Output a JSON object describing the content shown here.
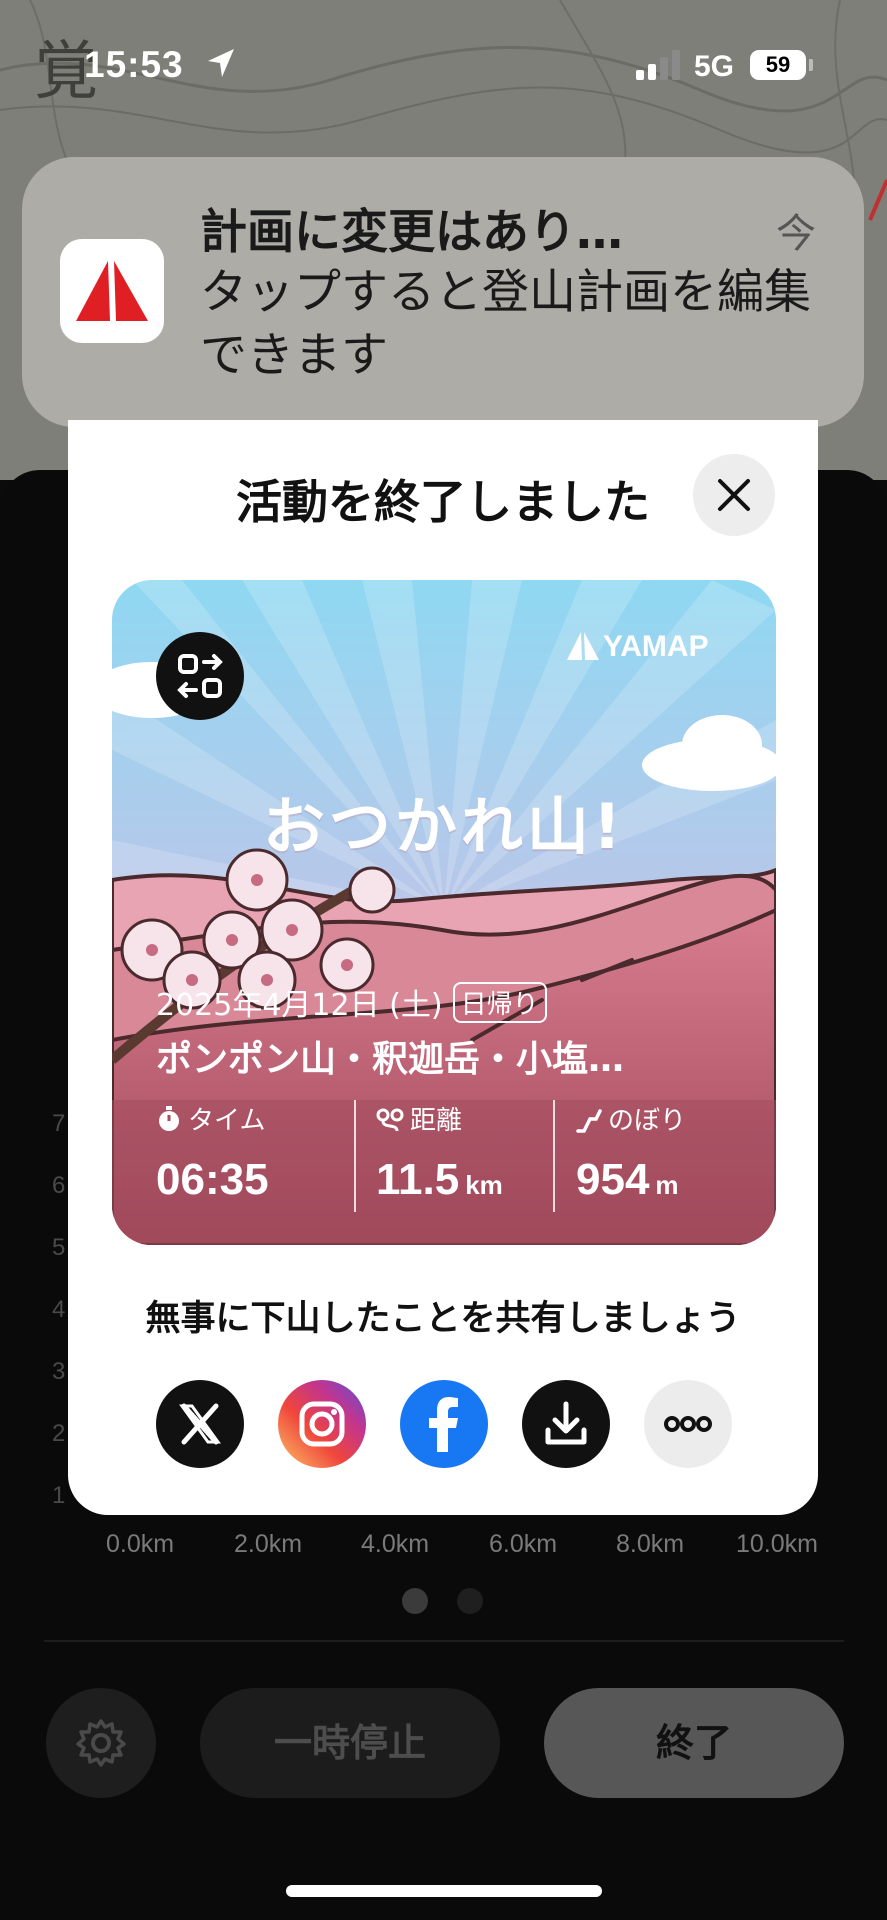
{
  "status_bar": {
    "time": "15:53",
    "network": "5G",
    "battery": "59"
  },
  "map": {
    "label": "覚"
  },
  "notification": {
    "title": "計画に変更はあり…",
    "time": "今",
    "body": "タップすると登山計画を編集できます"
  },
  "modal": {
    "title": "活動を終了しました",
    "card": {
      "brand": "YAMAP",
      "headline": "おつかれ山!",
      "date": "2025年4月12日 (土)",
      "trip_type": "日帰り",
      "mountains": "ポンポン山・釈迦岳・小塩…",
      "stats": [
        {
          "label": "タイム",
          "value": "06:35",
          "unit": ""
        },
        {
          "label": "距離",
          "value": "11.5",
          "unit": "km"
        },
        {
          "label": "のぼり",
          "value": "954",
          "unit": "m"
        }
      ]
    },
    "share_text": "無事に下山したことを共有しましょう",
    "share_buttons": [
      "x-icon",
      "instagram-icon",
      "facebook-icon",
      "download-icon",
      "more-icon"
    ]
  },
  "graph": {
    "x_ticks": [
      "0.0km",
      "2.0km",
      "4.0km",
      "6.0km",
      "8.0km",
      "10.0km"
    ],
    "y_ticks": [
      "7",
      "6",
      "5",
      "4",
      "3",
      "2",
      "1"
    ],
    "page_index": 1,
    "page_count": 2
  },
  "controls": {
    "pause_label": "一時停止",
    "end_label": "終了"
  },
  "colors": {
    "accent_red": "#e01f25",
    "facebook": "#1877f2",
    "card_pink": "#b4586c"
  }
}
